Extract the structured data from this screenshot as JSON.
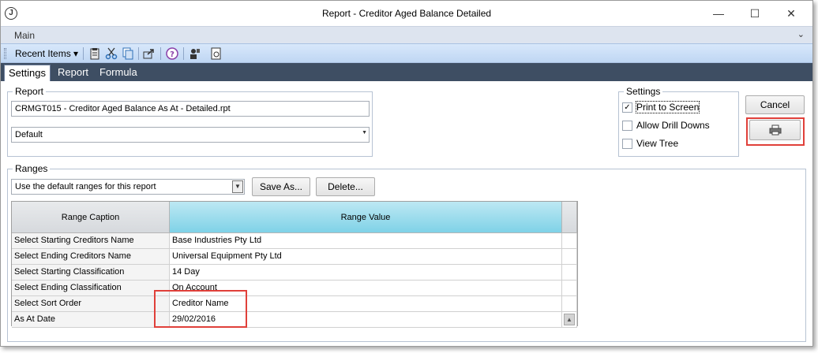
{
  "window": {
    "title": "Report - Creditor Aged Balance Detailed",
    "app_icon_glyph": "J",
    "min_glyph": "—",
    "max_glyph": "☐",
    "close_glyph": "✕"
  },
  "ribbon": {
    "main_label": "Main",
    "collapse_glyph": "⌄",
    "recent_items_label": "Recent Items ▾"
  },
  "tabs": [
    {
      "label": "Settings",
      "active": true
    },
    {
      "label": "Report",
      "active": false
    },
    {
      "label": "Formula",
      "active": false
    }
  ],
  "report_group": {
    "legend": "Report",
    "file_value": "CRMGT015 - Creditor Aged Balance As At - Detailed.rpt",
    "layout_value": "Default"
  },
  "settings_group": {
    "legend": "Settings",
    "print_to_screen": {
      "label": "Print to Screen",
      "checked": true
    },
    "allow_drill_downs": {
      "label": "Allow Drill Downs",
      "checked": false
    },
    "view_tree": {
      "label": "View Tree",
      "checked": false
    }
  },
  "buttons": {
    "cancel": "Cancel",
    "save_as": "Save As...",
    "delete": "Delete..."
  },
  "ranges_group": {
    "legend": "Ranges",
    "preset_value": "Use the default ranges for this report"
  },
  "grid": {
    "headers": {
      "caption": "Range Caption",
      "value": "Range Value"
    },
    "rows": [
      {
        "caption": "Select Starting Creditors Name",
        "value": "Base Industries Pty Ltd"
      },
      {
        "caption": "Select Ending Creditors Name",
        "value": "Universal Equipment Pty Ltd"
      },
      {
        "caption": "Select Starting Classification",
        "value": "14 Day"
      },
      {
        "caption": "Select Ending Classification",
        "value": "On Account"
      },
      {
        "caption": "Select Sort Order",
        "value": "Creditor Name"
      },
      {
        "caption": "As At Date",
        "value": "29/02/2016"
      }
    ]
  },
  "colors": {
    "highlight": "#e0403a",
    "tab_bar": "#3e4e63",
    "header_accent": "#7fd2e7"
  }
}
